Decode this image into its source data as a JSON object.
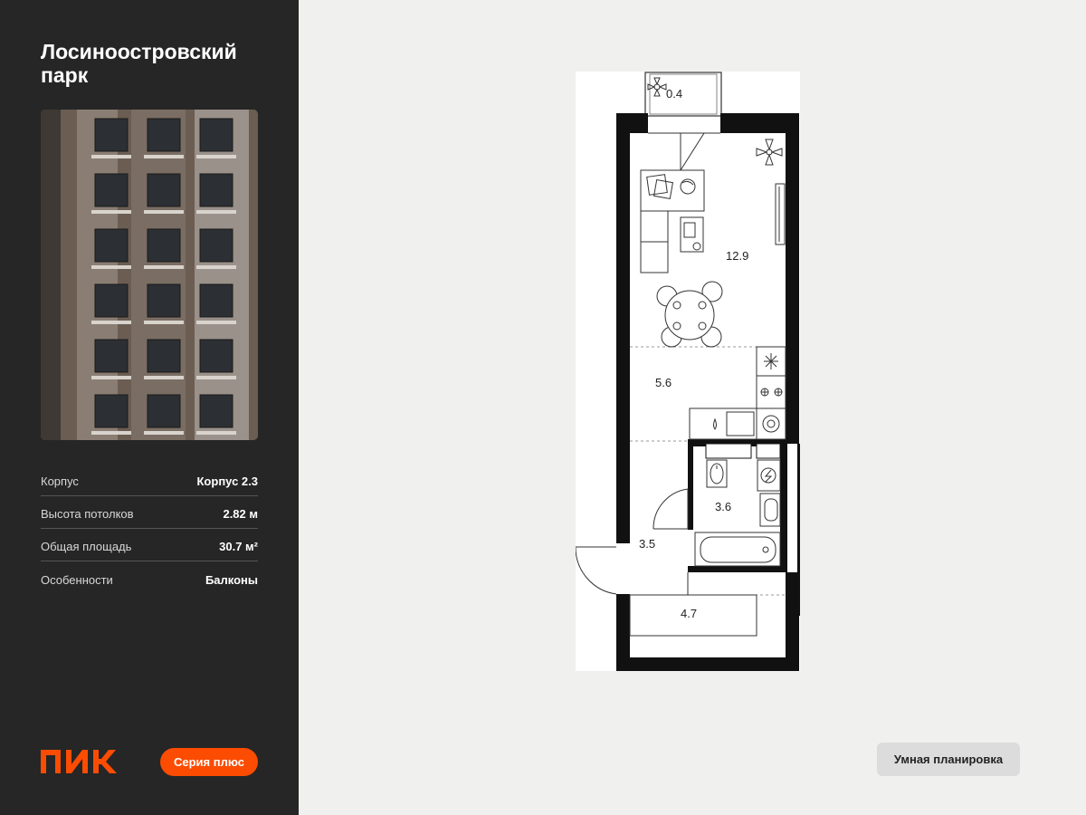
{
  "project": {
    "title": "Лосиноостровский парк"
  },
  "specs": [
    {
      "label": "Корпус",
      "value": "Корпус 2.3"
    },
    {
      "label": "Высота потолков",
      "value": "2.82 м"
    },
    {
      "label": "Общая площадь",
      "value": "30.7 м²"
    },
    {
      "label": "Особенности",
      "value": "Балконы"
    }
  ],
  "brand": {
    "logo_text": "ПИК",
    "series_label": "Серия плюс",
    "accent": "#fc4c02"
  },
  "plan": {
    "rooms": {
      "balcony": "0.4",
      "living": "12.9",
      "kitchen": "5.6",
      "bathroom": "3.6",
      "hall": "3.5",
      "storage": "4.7"
    }
  },
  "actions": {
    "smart_layout": "Умная планировка"
  },
  "icons": [
    "pik-logo",
    "plant-icon",
    "sofa-icon",
    "desk-icon",
    "dining-table-icon",
    "stove-icon",
    "fridge-icon",
    "sink-icon",
    "washer-icon",
    "toilet-icon",
    "bathtub-icon",
    "door-icon",
    "radiator-icon"
  ]
}
